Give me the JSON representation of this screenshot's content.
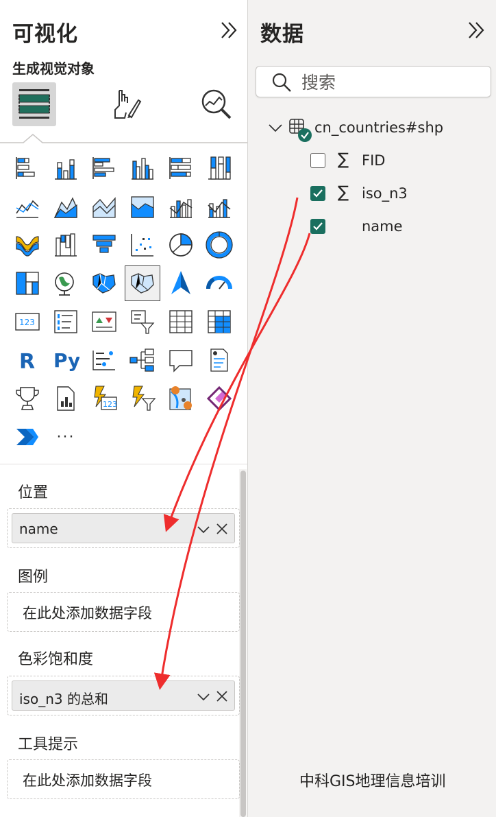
{
  "viz_pane": {
    "title": "可视化",
    "subtitle": "生成视觉对象",
    "tabs": [
      "build-visual",
      "format-visual",
      "analytics"
    ],
    "more_label": "···",
    "wells": {
      "location": {
        "label": "位置",
        "field": "name"
      },
      "legend": {
        "label": "图例",
        "placeholder": "在此处添加数据字段"
      },
      "saturation": {
        "label": "色彩饱和度",
        "field": "iso_n3 的总和"
      },
      "tooltips": {
        "label": "工具提示",
        "placeholder": "在此处添加数据字段"
      }
    }
  },
  "data_pane": {
    "title": "数据",
    "search_placeholder": "搜索",
    "table": {
      "name": "cn_countries#shp",
      "fields": [
        {
          "name": "FID",
          "checked": false,
          "sigma": true
        },
        {
          "name": "iso_n3",
          "checked": true,
          "sigma": true
        },
        {
          "name": "name",
          "checked": true,
          "sigma": false
        }
      ]
    }
  },
  "watermark": "中科GIS地理信息培训",
  "colors": {
    "accent": "#1a6f5f",
    "viz_blue": "#118dff",
    "arrow_red": "#ee2d2d"
  },
  "viz_icons": [
    "stacked-bar-icon",
    "stacked-column-icon",
    "clustered-bar-icon",
    "clustered-column-icon",
    "100-percent-bar-icon",
    "100-percent-column-icon",
    "line-chart-icon",
    "area-chart-icon",
    "stacked-area-icon",
    "100-area-icon",
    "line-column-icon",
    "line-stacked-column-icon",
    "ribbon-chart-icon",
    "waterfall-icon",
    "funnel-icon",
    "scatter-icon",
    "pie-chart-icon",
    "donut-chart-icon",
    "treemap-icon",
    "map-icon",
    "filled-map-icon",
    "shape-map-icon",
    "azure-map-icon",
    "gauge-icon",
    "card-icon",
    "multi-row-card-icon",
    "kpi-icon",
    "slicer-icon",
    "table-icon",
    "matrix-icon",
    "r-visual-icon",
    "python-visual-icon",
    "key-influencers-icon",
    "decomposition-tree-icon",
    "qa-icon",
    "smart-narrative-icon",
    "goals-icon",
    "paginated-report-icon",
    "power-apps-card-icon",
    "power-apps-slicer-icon",
    "arcgis-map-icon",
    "power-apps-icon",
    "power-automate-icon"
  ]
}
